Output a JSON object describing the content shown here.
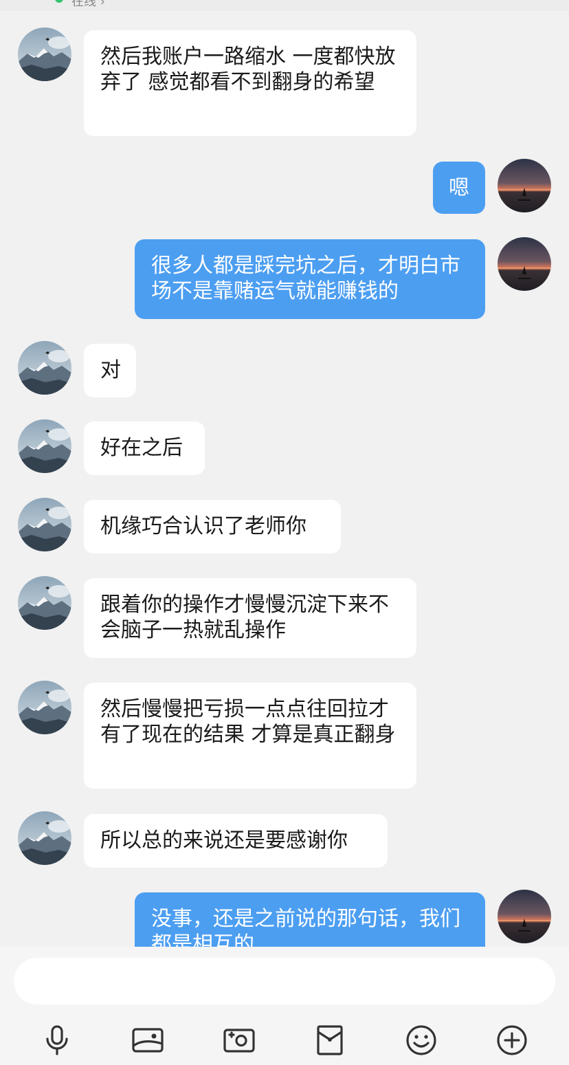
{
  "status": {
    "online_text": "在线 ›"
  },
  "messages": [
    {
      "side": "in",
      "text": "然后我账户一路缩水 一度都快放弃了 感觉都看不到翻身的希望"
    },
    {
      "side": "out",
      "text": "嗯"
    },
    {
      "side": "out",
      "text": "很多人都是踩完坑之后，才明白市场不是靠赌运气就能赚钱的"
    },
    {
      "side": "in",
      "text": "对"
    },
    {
      "side": "in",
      "text": "好在之后"
    },
    {
      "side": "in",
      "text": "机缘巧合认识了老师你"
    },
    {
      "side": "in",
      "text": "跟着你的操作才慢慢沉淀下来不会脑子一热就乱操作"
    },
    {
      "side": "in",
      "text": "然后慢慢把亏损一点点往回拉才有了现在的结果 才算是真正翻身"
    },
    {
      "side": "in",
      "text": "所以总的来说还是要感谢你"
    },
    {
      "side": "out",
      "text": "没事，还是之前说的那句话，我们都是相互的"
    }
  ],
  "avatars": {
    "contact": "mountain-avatar",
    "self": "sunset-lake-avatar"
  },
  "input": {
    "placeholder": ""
  },
  "toolbar": {
    "icons": [
      "microphone-icon",
      "image-icon",
      "camera-icon",
      "red-packet-icon",
      "emoji-icon",
      "plus-icon"
    ]
  },
  "colors": {
    "background": "#f1f1f1",
    "incoming_bubble": "#ffffff",
    "outgoing_bubble": "#4c9ef1",
    "online": "#33c46a"
  }
}
